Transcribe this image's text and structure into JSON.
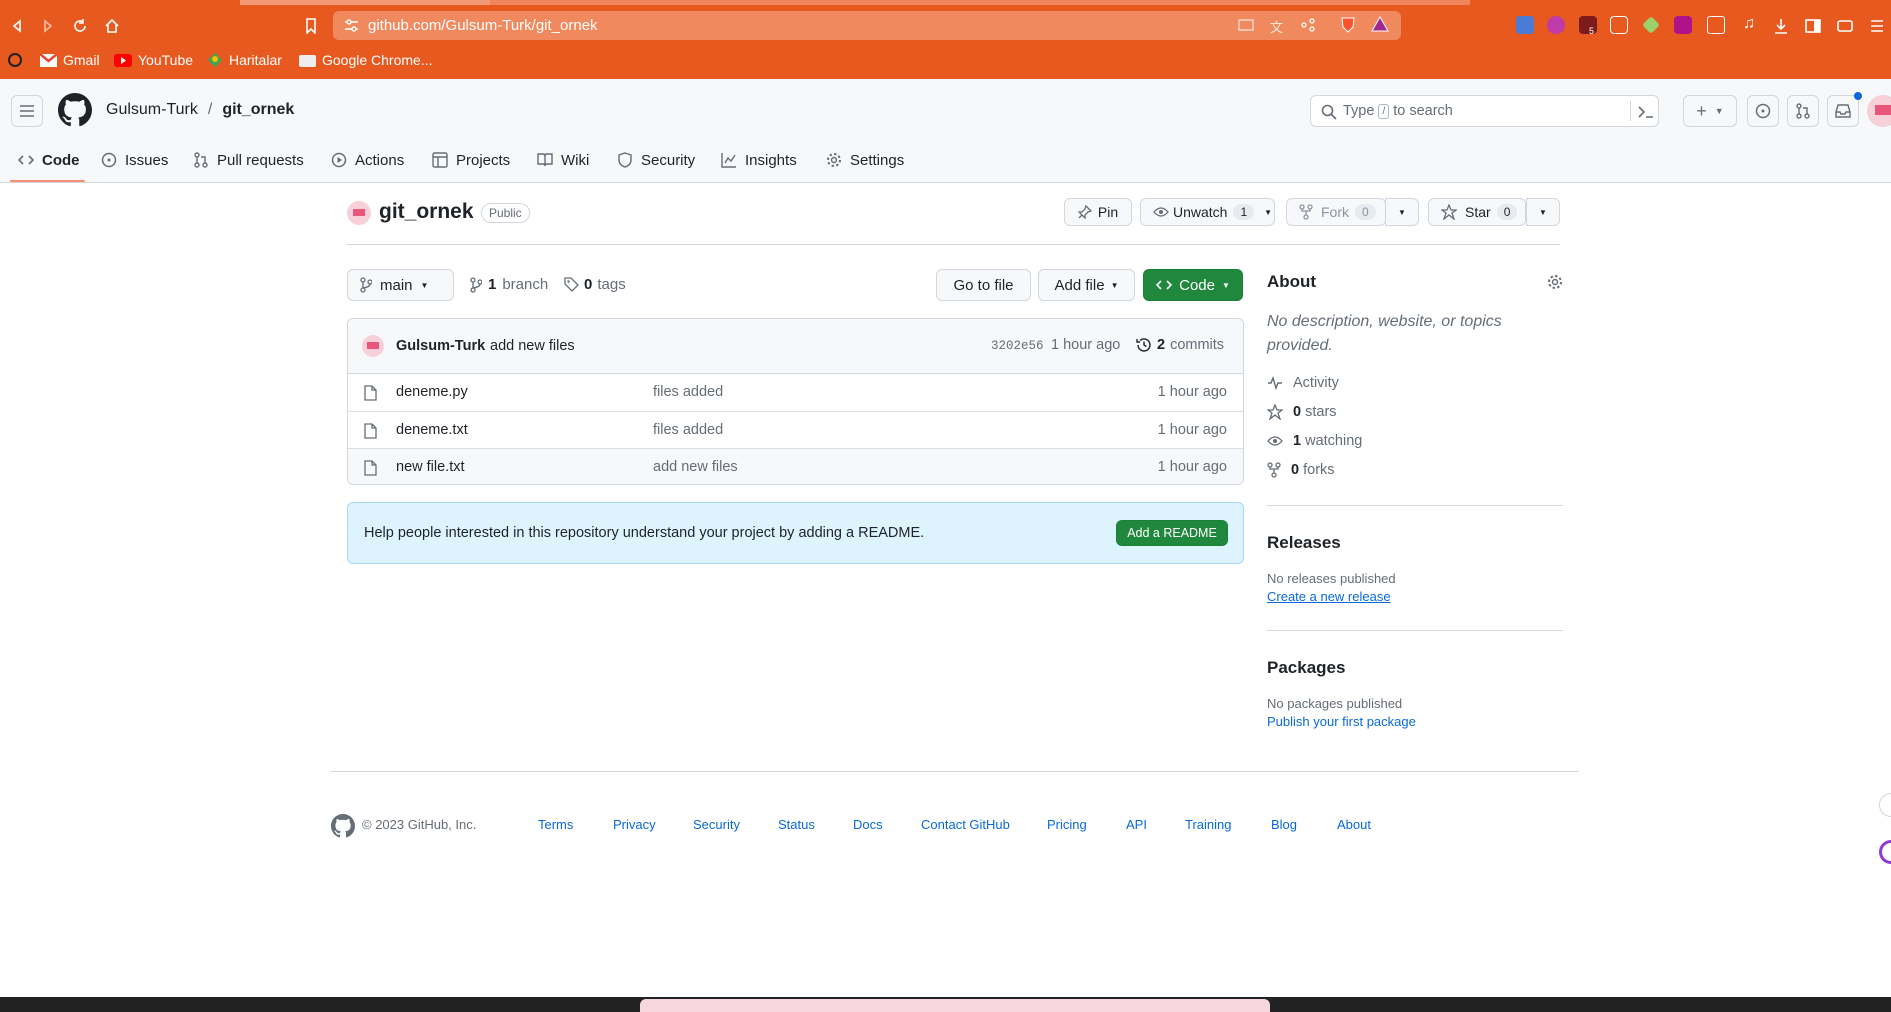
{
  "browser": {
    "url": "github.com/Gulsum-Turk/git_ornek",
    "bookmarks": [
      "Gmail",
      "YouTube",
      "Haritalar",
      "Google Chrome..."
    ],
    "extension_badge": "5"
  },
  "header": {
    "owner": "Gulsum-Turk",
    "separator": "/",
    "repo": "git_ornek",
    "search_placeholder_prefix": "Type",
    "search_key": "/",
    "search_placeholder_suffix": "to search"
  },
  "nav": {
    "tabs": [
      {
        "label": "Code",
        "icon": "code-icon"
      },
      {
        "label": "Issues",
        "icon": "issue-icon"
      },
      {
        "label": "Pull requests",
        "icon": "pull-request-icon"
      },
      {
        "label": "Actions",
        "icon": "play-icon"
      },
      {
        "label": "Projects",
        "icon": "table-icon"
      },
      {
        "label": "Wiki",
        "icon": "book-icon"
      },
      {
        "label": "Security",
        "icon": "shield-icon"
      },
      {
        "label": "Insights",
        "icon": "graph-icon"
      },
      {
        "label": "Settings",
        "icon": "gear-icon"
      }
    ],
    "active": "Code"
  },
  "repo": {
    "name": "git_ornek",
    "visibility": "Public",
    "pin_label": "Pin",
    "unwatch_label": "Unwatch",
    "watch_count": "1",
    "fork_label": "Fork",
    "fork_count": "0",
    "star_label": "Star",
    "star_count": "0"
  },
  "toolbar": {
    "branch": "main",
    "branch_count": "1",
    "branch_label": "branch",
    "tag_count": "0",
    "tag_label": "tags",
    "go_to_file": "Go to file",
    "add_file": "Add file",
    "code": "Code"
  },
  "commit": {
    "author": "Gulsum-Turk",
    "message": "add new files",
    "sha": "3202e56",
    "time": "1 hour ago",
    "count": "2",
    "count_label": "commits"
  },
  "files": [
    {
      "name": "deneme.py",
      "message": "files added",
      "age": "1 hour ago"
    },
    {
      "name": "deneme.txt",
      "message": "files added",
      "age": "1 hour ago"
    },
    {
      "name": "new file.txt",
      "message": "add new files",
      "age": "1 hour ago"
    }
  ],
  "readme_banner": {
    "text": "Help people interested in this repository understand your project by adding a README.",
    "button": "Add a README"
  },
  "about": {
    "title": "About",
    "description": "No description, website, or topics provided.",
    "activity": "Activity",
    "stars_count": "0",
    "stars_label": "stars",
    "watching_count": "1",
    "watching_label": "watching",
    "forks_count": "0",
    "forks_label": "forks"
  },
  "releases": {
    "title": "Releases",
    "none": "No releases published",
    "link": "Create a new release"
  },
  "packages": {
    "title": "Packages",
    "none": "No packages published",
    "link": "Publish your first package"
  },
  "footer": {
    "copyright": "© 2023 GitHub, Inc.",
    "links": [
      "Terms",
      "Privacy",
      "Security",
      "Status",
      "Docs",
      "Contact GitHub",
      "Pricing",
      "API",
      "Training",
      "Blog",
      "About"
    ]
  },
  "colors": {
    "browser_bar": "#e8591f",
    "primary_green": "#1f883d",
    "link_blue": "#0969da",
    "active_tab_underline": "#fd8c73"
  }
}
